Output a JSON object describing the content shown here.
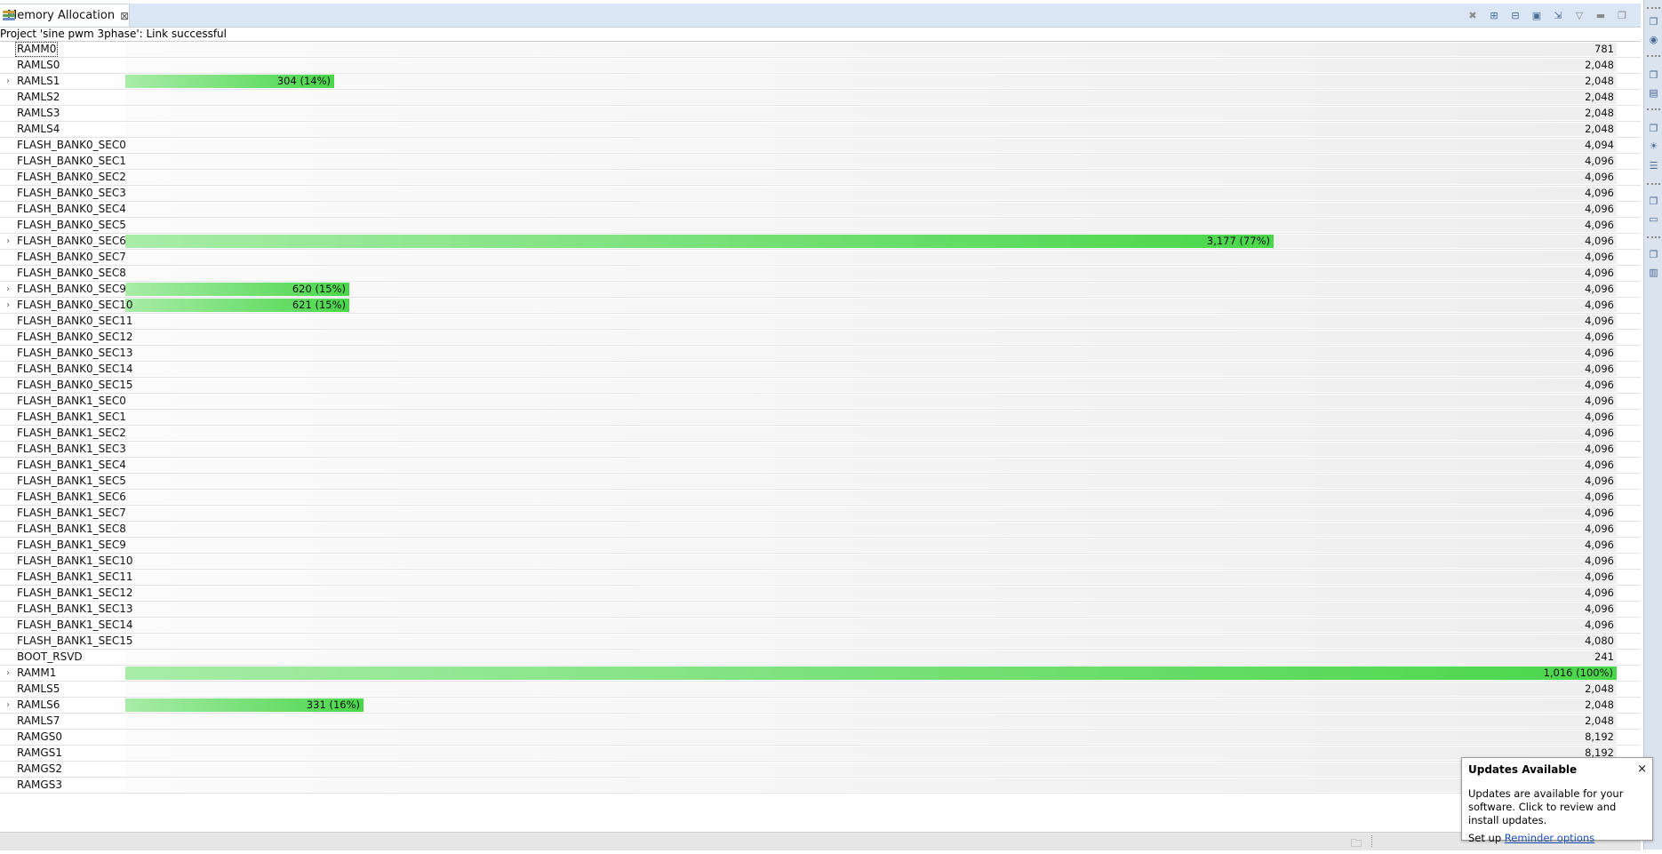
{
  "tab": {
    "title": "Memory Allocation",
    "close": "⊠"
  },
  "status_line": "Project 'sine pwm 3phase': Link successful",
  "toolbar_icons": [
    "close-all-icon",
    "expand-all-icon",
    "collapse-all-icon",
    "new-view-icon",
    "export-icon",
    "view-menu-icon",
    "minimize-icon",
    "maximize-icon"
  ],
  "rows": [
    {
      "name": "RAMM0",
      "size": "781",
      "expandable": false,
      "selected": true
    },
    {
      "name": "RAMLS0",
      "size": "2,048",
      "expandable": false
    },
    {
      "name": "RAMLS1",
      "size": "2,048",
      "expandable": true,
      "used_label": "304 (14%)",
      "fill": 0.14
    },
    {
      "name": "RAMLS2",
      "size": "2,048",
      "expandable": false
    },
    {
      "name": "RAMLS3",
      "size": "2,048",
      "expandable": false
    },
    {
      "name": "RAMLS4",
      "size": "2,048",
      "expandable": false
    },
    {
      "name": "FLASH_BANK0_SEC0",
      "size": "4,094",
      "expandable": false
    },
    {
      "name": "FLASH_BANK0_SEC1",
      "size": "4,096",
      "expandable": false
    },
    {
      "name": "FLASH_BANK0_SEC2",
      "size": "4,096",
      "expandable": false
    },
    {
      "name": "FLASH_BANK0_SEC3",
      "size": "4,096",
      "expandable": false
    },
    {
      "name": "FLASH_BANK0_SEC4",
      "size": "4,096",
      "expandable": false
    },
    {
      "name": "FLASH_BANK0_SEC5",
      "size": "4,096",
      "expandable": false
    },
    {
      "name": "FLASH_BANK0_SEC6",
      "size": "4,096",
      "expandable": true,
      "used_label": "3,177 (77%)",
      "fill": 0.77
    },
    {
      "name": "FLASH_BANK0_SEC7",
      "size": "4,096",
      "expandable": false
    },
    {
      "name": "FLASH_BANK0_SEC8",
      "size": "4,096",
      "expandable": false
    },
    {
      "name": "FLASH_BANK0_SEC9",
      "size": "4,096",
      "expandable": true,
      "used_label": "620 (15%)",
      "fill": 0.15
    },
    {
      "name": "FLASH_BANK0_SEC10",
      "size": "4,096",
      "expandable": true,
      "used_label": "621 (15%)",
      "fill": 0.15
    },
    {
      "name": "FLASH_BANK0_SEC11",
      "size": "4,096",
      "expandable": false
    },
    {
      "name": "FLASH_BANK0_SEC12",
      "size": "4,096",
      "expandable": false
    },
    {
      "name": "FLASH_BANK0_SEC13",
      "size": "4,096",
      "expandable": false
    },
    {
      "name": "FLASH_BANK0_SEC14",
      "size": "4,096",
      "expandable": false
    },
    {
      "name": "FLASH_BANK0_SEC15",
      "size": "4,096",
      "expandable": false
    },
    {
      "name": "FLASH_BANK1_SEC0",
      "size": "4,096",
      "expandable": false
    },
    {
      "name": "FLASH_BANK1_SEC1",
      "size": "4,096",
      "expandable": false
    },
    {
      "name": "FLASH_BANK1_SEC2",
      "size": "4,096",
      "expandable": false
    },
    {
      "name": "FLASH_BANK1_SEC3",
      "size": "4,096",
      "expandable": false
    },
    {
      "name": "FLASH_BANK1_SEC4",
      "size": "4,096",
      "expandable": false
    },
    {
      "name": "FLASH_BANK1_SEC5",
      "size": "4,096",
      "expandable": false
    },
    {
      "name": "FLASH_BANK1_SEC6",
      "size": "4,096",
      "expandable": false
    },
    {
      "name": "FLASH_BANK1_SEC7",
      "size": "4,096",
      "expandable": false
    },
    {
      "name": "FLASH_BANK1_SEC8",
      "size": "4,096",
      "expandable": false
    },
    {
      "name": "FLASH_BANK1_SEC9",
      "size": "4,096",
      "expandable": false
    },
    {
      "name": "FLASH_BANK1_SEC10",
      "size": "4,096",
      "expandable": false
    },
    {
      "name": "FLASH_BANK1_SEC11",
      "size": "4,096",
      "expandable": false
    },
    {
      "name": "FLASH_BANK1_SEC12",
      "size": "4,096",
      "expandable": false
    },
    {
      "name": "FLASH_BANK1_SEC13",
      "size": "4,096",
      "expandable": false
    },
    {
      "name": "FLASH_BANK1_SEC14",
      "size": "4,096",
      "expandable": false
    },
    {
      "name": "FLASH_BANK1_SEC15",
      "size": "4,080",
      "expandable": false
    },
    {
      "name": "BOOT_RSVD",
      "size": "241",
      "expandable": false
    },
    {
      "name": "RAMM1",
      "size": "",
      "expandable": true,
      "used_label": "1,016 (100%)",
      "fill": 1.0
    },
    {
      "name": "RAMLS5",
      "size": "2,048",
      "expandable": false
    },
    {
      "name": "RAMLS6",
      "size": "2,048",
      "expandable": true,
      "used_label": "331 (16%)",
      "fill": 0.16
    },
    {
      "name": "RAMLS7",
      "size": "2,048",
      "expandable": false
    },
    {
      "name": "RAMGS0",
      "size": "8,192",
      "expandable": false
    },
    {
      "name": "RAMGS1",
      "size": "8,192",
      "expandable": false
    },
    {
      "name": "RAMGS2",
      "size": "",
      "expandable": false
    },
    {
      "name": "RAMGS3",
      "size": "",
      "expandable": false
    }
  ],
  "popup": {
    "title": "Updates Available",
    "close": "×",
    "body": "Updates are available for your software. Click to review and install updates.",
    "footer_prefix": "Set up ",
    "footer_link": "Reminder options"
  },
  "colors": {
    "fill_start": "#a8eca8",
    "fill_end": "#4ad64a",
    "tab_bar": "#dbe6f4"
  }
}
